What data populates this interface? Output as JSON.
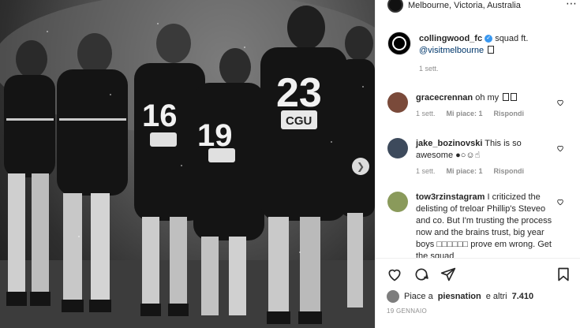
{
  "post": {
    "location": "Melbourne, Victoria, Australia",
    "author": "collingwood_fc",
    "verified_icon": "verified-badge-icon",
    "caption_text": "squad ft.",
    "caption_mention": "@visitmelbourne",
    "age": "1 sett.",
    "jersey_numbers": [
      "16",
      "19",
      "23"
    ],
    "sponsor_text": "CGU"
  },
  "comments": [
    {
      "user": "gracecrennan",
      "text": "oh my",
      "age": "1 sett.",
      "likes": "Mi piace: 1",
      "reply": "Rispondi",
      "avatar_color": "#7a4a3a"
    },
    {
      "user": "jake_bozinovski",
      "text": "This is so awesome ●○☺☝",
      "age": "1 sett.",
      "likes": "Mi piace: 1",
      "reply": "Rispondi",
      "avatar_color": "#3d4a5c"
    },
    {
      "user": "tow3rzinstagram",
      "text": "I criticized the delisting of treloar Phillip's Steveo and co. But I'm trusting the process now and the brains trust, big year boys □□□□□□ prove em wrong. Get the squad",
      "age": "",
      "likes": "",
      "reply": "",
      "avatar_color": "#8a9a5b"
    }
  ],
  "actions": {
    "likes_prefix": "Piace a",
    "likes_user": "piesnation",
    "likes_mid": "e altri",
    "likes_count": "7.410",
    "date": "19 GENNAIO"
  },
  "colors": {
    "link": "#00376b",
    "meta": "#8e8e8e",
    "verified": "#3897f0"
  }
}
